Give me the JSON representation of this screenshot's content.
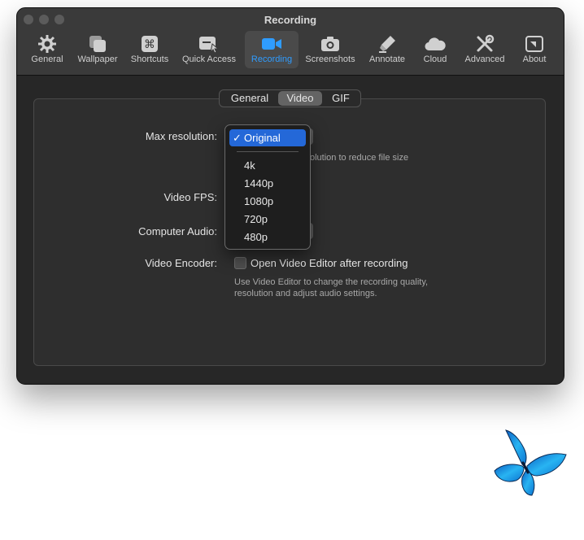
{
  "window": {
    "title": "Recording"
  },
  "toolbar": {
    "tabs": [
      {
        "label": "General",
        "icon": "gear-icon"
      },
      {
        "label": "Wallpaper",
        "icon": "wallpaper-icon"
      },
      {
        "label": "Shortcuts",
        "icon": "command-icon"
      },
      {
        "label": "Quick Access",
        "icon": "quick-access-icon"
      },
      {
        "label": "Recording",
        "icon": "video-camera-icon"
      },
      {
        "label": "Screenshots",
        "icon": "camera-icon"
      },
      {
        "label": "Annotate",
        "icon": "marker-icon"
      },
      {
        "label": "Cloud",
        "icon": "cloud-icon"
      },
      {
        "label": "Advanced",
        "icon": "tools-icon"
      },
      {
        "label": "About",
        "icon": "about-icon"
      }
    ],
    "active": "Recording",
    "accent": "#2f9cff"
  },
  "segments": {
    "items": [
      "General",
      "Video",
      "GIF"
    ],
    "selected": "Video"
  },
  "settings": {
    "max_resolution_label": "Max resolution:",
    "resolution_hint": "olution to reduce file size",
    "video_fps_label": "Video FPS:",
    "computer_audio_label": "Computer Audio:",
    "video_encoder_label": "Video Encoder:",
    "open_editor_label": "Open Video Editor after recording",
    "open_editor_checked": false,
    "editor_hint_line1": "Use Video Editor to change the recording quality,",
    "editor_hint_line2": "resolution and adjust audio settings."
  },
  "dropdown": {
    "selected_mark": "✓",
    "selected": "Original",
    "options": [
      "4k",
      "1440p",
      "1080p",
      "720p",
      "480p"
    ],
    "highlight": "#2468d8"
  },
  "decoration": {
    "icon": "butterfly-icon",
    "color": "#1e9ce8"
  }
}
